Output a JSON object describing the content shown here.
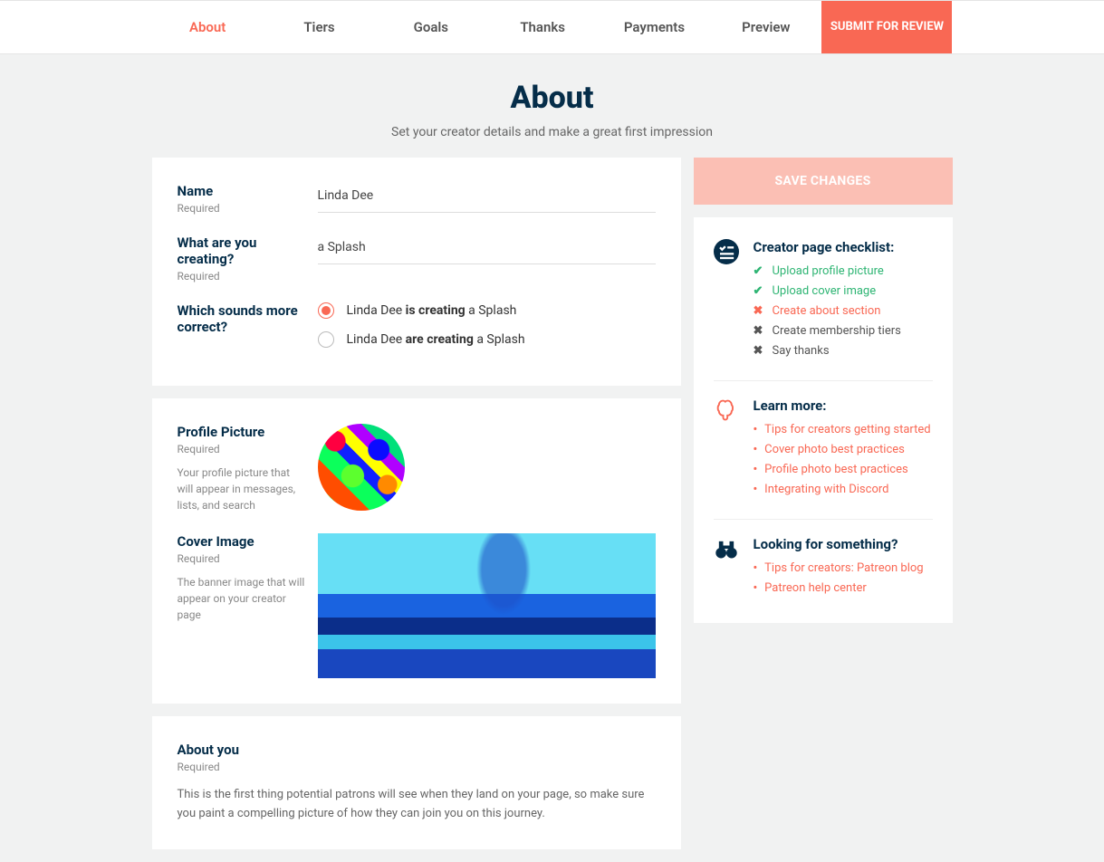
{
  "tabs": {
    "items": [
      "About",
      "Tiers",
      "Goals",
      "Thanks",
      "Payments",
      "Preview"
    ],
    "active": 0,
    "submit": "SUBMIT FOR REVIEW"
  },
  "header": {
    "title": "About",
    "subtitle": "Set your creator details and make a great first impression"
  },
  "form": {
    "name": {
      "label": "Name",
      "required": "Required",
      "value": "Linda Dee"
    },
    "creating": {
      "label": "What are you creating?",
      "required": "Required",
      "value": "a Splash"
    },
    "sounds": {
      "label": "Which sounds more correct?",
      "opt1_prefix": "Linda Dee ",
      "opt1_bold": "is creating",
      "opt1_suffix": " a Splash",
      "opt2_prefix": "Linda Dee ",
      "opt2_bold": "are creating",
      "opt2_suffix": " a Splash",
      "selected": 0
    },
    "profile": {
      "label": "Profile Picture",
      "required": "Required",
      "help": "Your profile picture that will appear in messages, lists, and search"
    },
    "cover": {
      "label": "Cover Image",
      "required": "Required",
      "help": "The banner image that will appear on your creator page"
    },
    "aboutyou": {
      "label": "About you",
      "required": "Required",
      "desc": "This is the first thing potential patrons will see when they land on your page, so make sure you paint a compelling picture of how they can join you on this journey."
    }
  },
  "sidebar": {
    "save": "SAVE CHANGES",
    "checklist": {
      "title": "Creator page checklist:",
      "items": [
        {
          "label": "Upload profile picture",
          "state": "ok"
        },
        {
          "label": "Upload cover image",
          "state": "ok"
        },
        {
          "label": "Create about section",
          "state": "err"
        },
        {
          "label": "Create membership tiers",
          "state": "neutral"
        },
        {
          "label": "Say thanks",
          "state": "neutral"
        }
      ]
    },
    "learn": {
      "title": "Learn more:",
      "items": [
        "Tips for creators getting started",
        "Cover photo best practices",
        "Profile photo best practices",
        "Integrating with Discord"
      ]
    },
    "looking": {
      "title": "Looking for something?",
      "items": [
        "Tips for creators: Patreon blog",
        "Patreon help center"
      ]
    }
  }
}
